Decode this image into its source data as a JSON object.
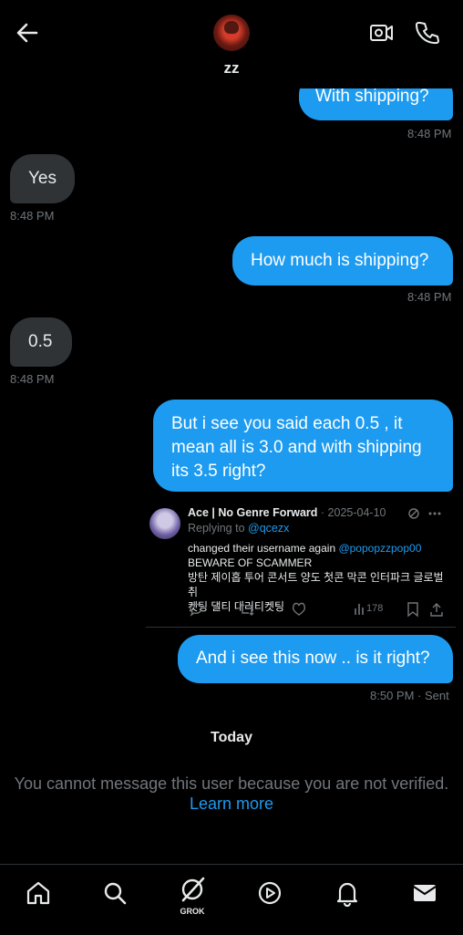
{
  "header": {
    "contact_name": "zz"
  },
  "messages": [
    {
      "text": "With shipping?",
      "time": "8:48 PM"
    },
    {
      "text": "Yes",
      "time": "8:48 PM"
    },
    {
      "text": "How much is shipping?",
      "time": "8:48 PM"
    },
    {
      "text": "0.5",
      "time": "8:48 PM"
    },
    {
      "text_lines": [
        "But i see you said each 0.5 , it",
        "mean all is 3.0 and with shipping",
        "its 3.5 right?"
      ]
    },
    {
      "text": "And i see this now .. is it right?",
      "time": "8:50 PM",
      "status": "· Sent"
    }
  ],
  "quote": {
    "author": "Ace | No Genre Forward",
    "date": "· 2025-04-10",
    "replying_prefix": "Replying to ",
    "replying_handle": "@qcezx",
    "body_prefix": "changed their username again ",
    "body_handle": "@popopzzpop00",
    "body_line2": "BEWARE OF SCAMMER",
    "body_line3": "방탄 제이홉 투어 콘서트 양도 첫콘 막콘 인터파크 글로벌 취",
    "body_line4": "켓팅 댈티 대리티켓팅",
    "views": "178"
  },
  "day_divider": "Today",
  "notice": {
    "text": "You cannot message this user because you are not verified.",
    "link": "Learn more"
  },
  "bottom_nav": {
    "grok_label": "GROK"
  },
  "colors": {
    "accent": "#1d9bf0",
    "incoming_bubble": "#2f3336",
    "muted": "#71767b"
  }
}
